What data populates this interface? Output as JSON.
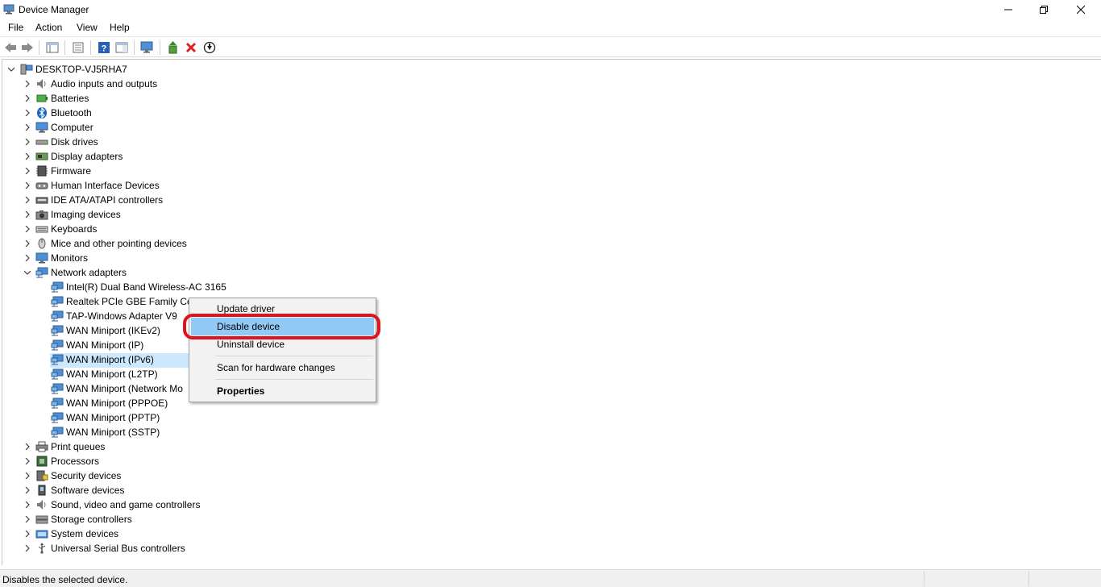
{
  "window": {
    "title": "Device Manager"
  },
  "menu": [
    "File",
    "Action",
    "View",
    "Help"
  ],
  "tree": {
    "root": "DESKTOP-VJ5RHA7",
    "categories": [
      {
        "label": "Audio inputs and outputs",
        "icon": "speaker-icon"
      },
      {
        "label": "Batteries",
        "icon": "battery-icon"
      },
      {
        "label": "Bluetooth",
        "icon": "bluetooth-icon"
      },
      {
        "label": "Computer",
        "icon": "computer-icon"
      },
      {
        "label": "Disk drives",
        "icon": "disk-drive-icon"
      },
      {
        "label": "Display adapters",
        "icon": "display-adapter-icon"
      },
      {
        "label": "Firmware",
        "icon": "firmware-icon"
      },
      {
        "label": "Human Interface Devices",
        "icon": "hid-icon"
      },
      {
        "label": "IDE ATA/ATAPI controllers",
        "icon": "ide-controller-icon"
      },
      {
        "label": "Imaging devices",
        "icon": "camera-icon"
      },
      {
        "label": "Keyboards",
        "icon": "keyboard-icon"
      },
      {
        "label": "Mice and other pointing devices",
        "icon": "mouse-icon"
      },
      {
        "label": "Monitors",
        "icon": "monitor-icon"
      },
      {
        "label": "Network adapters",
        "icon": "network-adapter-icon",
        "expanded": true
      },
      {
        "label": "Print queues",
        "icon": "printer-icon"
      },
      {
        "label": "Processors",
        "icon": "processor-icon"
      },
      {
        "label": "Security devices",
        "icon": "security-device-icon"
      },
      {
        "label": "Software devices",
        "icon": "software-device-icon"
      },
      {
        "label": "Sound, video and game controllers",
        "icon": "speaker-icon"
      },
      {
        "label": "Storage controllers",
        "icon": "storage-controller-icon"
      },
      {
        "label": "System devices",
        "icon": "system-device-icon"
      },
      {
        "label": "Universal Serial Bus controllers",
        "icon": "usb-icon"
      }
    ],
    "network_adapters": [
      "Intel(R) Dual Band Wireless-AC 3165",
      "Realtek PCIe GBE Family Con",
      "TAP-Windows Adapter V9",
      "WAN Miniport (IKEv2)",
      "WAN Miniport (IP)",
      "WAN Miniport (IPv6)",
      "WAN Miniport (L2TP)",
      "WAN Miniport (Network Mo",
      "WAN Miniport (PPPOE)",
      "WAN Miniport (PPTP)",
      "WAN Miniport (SSTP)"
    ]
  },
  "context_menu": {
    "update": "Update driver",
    "disable": "Disable device",
    "uninstall": "Uninstall device",
    "scan": "Scan for hardware changes",
    "properties": "Properties"
  },
  "status": {
    "text": "Disables the selected device."
  },
  "colors": {
    "highlight": "#91c9f7",
    "selection": "#cce8ff",
    "annotation": "#e0121c"
  }
}
